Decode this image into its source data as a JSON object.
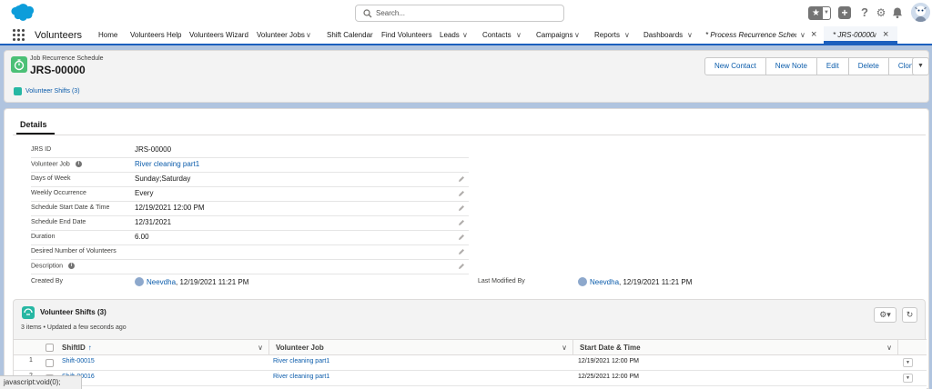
{
  "header": {
    "search_placeholder": "Search...",
    "icons": [
      "salesforce-cloud-icon",
      "search-icon",
      "favorite-star-icon",
      "chevron-down-icon",
      "add-icon",
      "help-icon",
      "gear-icon",
      "notification-bell-icon",
      "user-avatar"
    ]
  },
  "nav": {
    "app_name": "Volunteers",
    "items": [
      {
        "label": "Home",
        "has_menu": false
      },
      {
        "label": "Volunteers Help",
        "has_menu": false
      },
      {
        "label": "Volunteers Wizard",
        "has_menu": false
      },
      {
        "label": "Volunteer Jobs",
        "has_menu": true
      },
      {
        "label": "Shift Calendar",
        "has_menu": false
      },
      {
        "label": "Find Volunteers",
        "has_menu": false
      },
      {
        "label": "Leads",
        "has_menu": true
      },
      {
        "label": "Contacts",
        "has_menu": true
      },
      {
        "label": "Campaigns",
        "has_menu": true
      },
      {
        "label": "Reports",
        "has_menu": true
      },
      {
        "label": "Dashboards",
        "has_menu": true
      }
    ],
    "tabs": [
      {
        "label": "* Process Recurrence Schedu...",
        "active": false
      },
      {
        "label": "* JRS-00000",
        "active": true
      }
    ],
    "accent_color": "#1b5fbd"
  },
  "record": {
    "type": "Job Recurrence Schedule",
    "name": "JRS-00000",
    "icon_color": "#4bc076",
    "actions": [
      "New Contact",
      "New Note",
      "Edit",
      "Delete",
      "Clone"
    ],
    "related_link": "Volunteer Shifts (3)"
  },
  "details": {
    "tab_label": "Details",
    "fields": [
      {
        "label": "JRS ID",
        "value": "JRS-00000",
        "link": false,
        "editable": false,
        "info": false
      },
      {
        "label": "Volunteer Job",
        "value": "River cleaning part1",
        "link": true,
        "editable": false,
        "info": true
      },
      {
        "label": "Days of Week",
        "value": "Sunday;Saturday",
        "link": false,
        "editable": true,
        "info": false
      },
      {
        "label": "Weekly Occurrence",
        "value": "Every",
        "link": false,
        "editable": true,
        "info": false
      },
      {
        "label": "Schedule Start Date & Time",
        "value": "12/19/2021 12:00 PM",
        "link": false,
        "editable": true,
        "info": false
      },
      {
        "label": "Schedule End Date",
        "value": "12/31/2021",
        "link": false,
        "editable": true,
        "info": false
      },
      {
        "label": "Duration",
        "value": "6.00",
        "link": false,
        "editable": true,
        "info": false
      },
      {
        "label": "Desired Number of Volunteers",
        "value": "",
        "link": false,
        "editable": true,
        "info": false
      },
      {
        "label": "Description",
        "value": "",
        "link": false,
        "editable": true,
        "info": true
      }
    ],
    "created_by_label": "Created By",
    "created_by_user": "Neevdha",
    "created_by_date": ", 12/19/2021 11:21 PM",
    "modified_by_label": "Last Modified By",
    "modified_by_user": "Neevdha",
    "modified_by_date": ", 12/19/2021 11:21 PM"
  },
  "related_list": {
    "title": "Volunteer Shifts (3)",
    "subtitle": "3 items • Updated a few seconds ago",
    "icon_color": "#26b7a3",
    "columns": [
      "ShiftID",
      "Volunteer Job",
      "Start Date & Time"
    ],
    "rows": [
      {
        "num": "1",
        "shift_id": "Shift-00015",
        "job": "River cleaning part1",
        "start": "12/19/2021 12:00 PM"
      },
      {
        "num": "2",
        "shift_id": "Shift-00016",
        "job": "River cleaning part1",
        "start": "12/25/2021 12:00 PM"
      }
    ]
  },
  "status_bar": {
    "text": "javascript:void(0);"
  }
}
